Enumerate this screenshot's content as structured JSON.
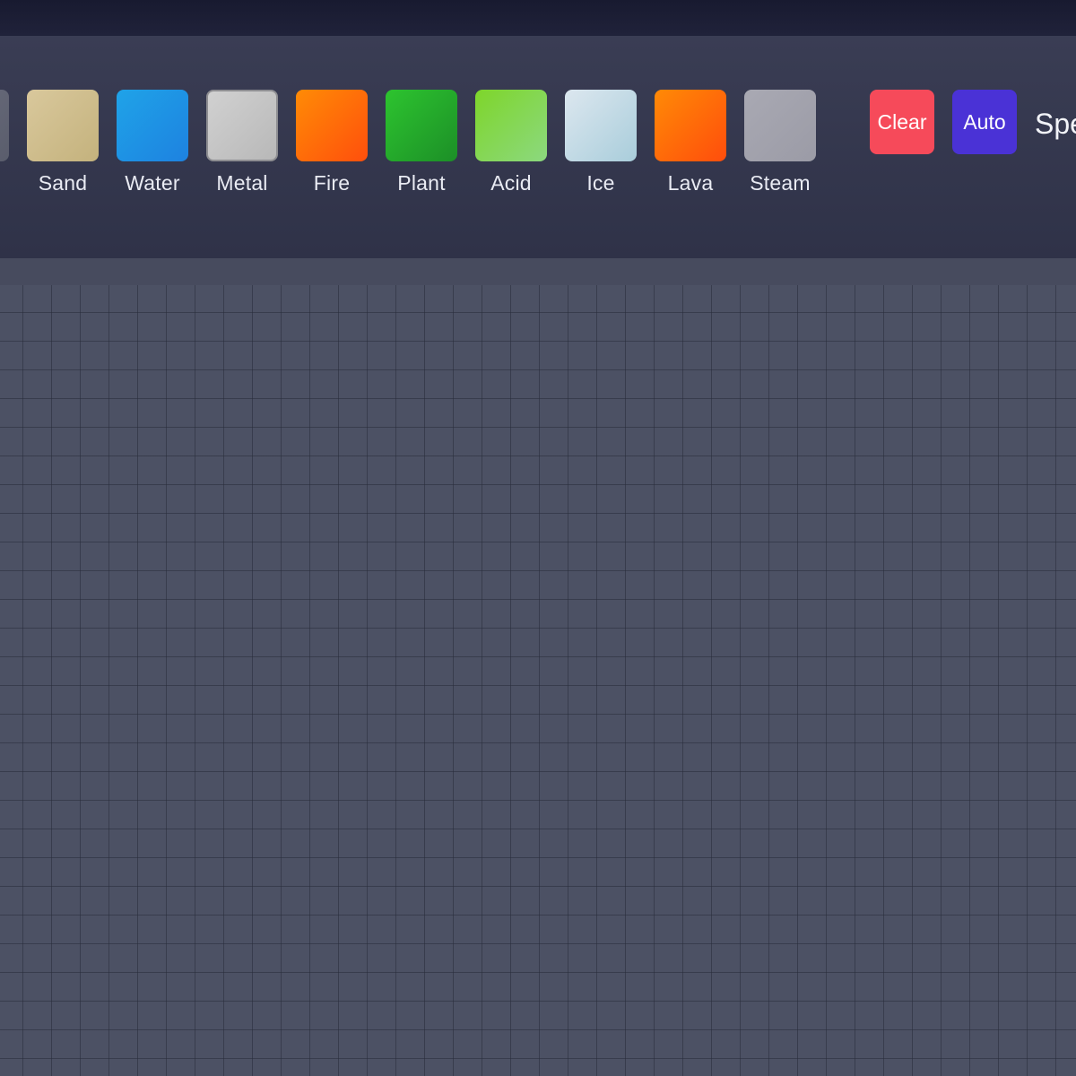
{
  "toolbar": {
    "materials": [
      {
        "id": "prev",
        "label": "",
        "colors": [
          "#6b6e7e",
          "#5a5d6c"
        ]
      },
      {
        "id": "sand",
        "label": "Sand",
        "colors": [
          "#d9c89c",
          "#c4b27d"
        ]
      },
      {
        "id": "water",
        "label": "Water",
        "colors": [
          "#1fa3e8",
          "#1e82e0"
        ]
      },
      {
        "id": "metal",
        "label": "Metal",
        "colors": [
          "#d1d1d1",
          "#b8b8b8"
        ]
      },
      {
        "id": "fire",
        "label": "Fire",
        "colors": [
          "#ff8b06",
          "#ff4f0c"
        ]
      },
      {
        "id": "plant",
        "label": "Plant",
        "colors": [
          "#2dc42f",
          "#1c8f27"
        ]
      },
      {
        "id": "acid",
        "label": "Acid",
        "colors": [
          "#7ed62a",
          "#8cd87f"
        ]
      },
      {
        "id": "ice",
        "label": "Ice",
        "colors": [
          "#dce7ef",
          "#a9cddb"
        ]
      },
      {
        "id": "lava",
        "label": "Lava",
        "colors": [
          "#ff8a06",
          "#ff4d0c"
        ]
      },
      {
        "id": "steam",
        "label": "Steam",
        "colors": [
          "#a9a9b3",
          "#9b9ba6"
        ]
      }
    ],
    "clear_label": "Clear",
    "clear_color": "#f64a5a",
    "auto_label": "Auto",
    "auto_color": "#4a32d6",
    "speed_label": "Speed"
  },
  "colors": {
    "topbar": "#1b1d33",
    "toolbar": "#33364c",
    "canvas": "#4c5164"
  }
}
